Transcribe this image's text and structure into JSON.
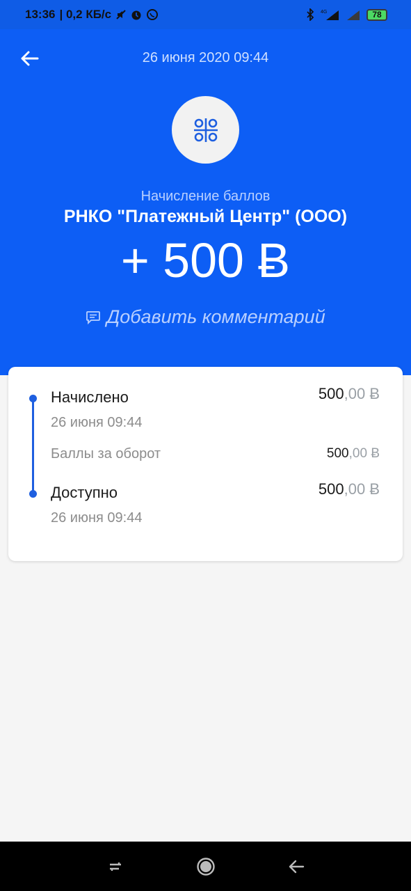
{
  "status_bar": {
    "time": "13:36",
    "speed": "| 0,2 КБ/с",
    "battery": "78",
    "icons": [
      "mute-icon",
      "alarm-icon",
      "whatsapp-icon",
      "bluetooth-icon",
      "signal-4g-icon",
      "signal-icon"
    ]
  },
  "header": {
    "back_icon": "arrow-left-icon",
    "date": "26 июня 2020 09:44"
  },
  "transaction": {
    "logo_icon": "qiwi-bonus-logo-icon",
    "subtitle": "Начисление баллов",
    "merchant": "РНКО \"Платежный Центр\" (ООО)",
    "amount": "+ 500 Ƀ",
    "comment_label": "Добавить комментарий",
    "comment_icon": "comment-icon"
  },
  "timeline": {
    "accrued": {
      "title": "Начислено",
      "date": "26 июня 09:44",
      "amount_int": "500",
      "amount_frac": ",00 Ƀ"
    },
    "turnover": {
      "label": "Баллы за оборот",
      "amount_int": "500",
      "amount_frac": ",00 Ƀ"
    },
    "available": {
      "title": "Доступно",
      "date": "26 июня 09:44",
      "amount_int": "500",
      "amount_frac": ",00 Ƀ"
    }
  },
  "nav_bar": {
    "icons": [
      "recents-icon",
      "home-icon",
      "back-icon"
    ]
  },
  "colors": {
    "brand_blue": "#0d5ef5",
    "timeline_blue": "#1e5fe0"
  }
}
